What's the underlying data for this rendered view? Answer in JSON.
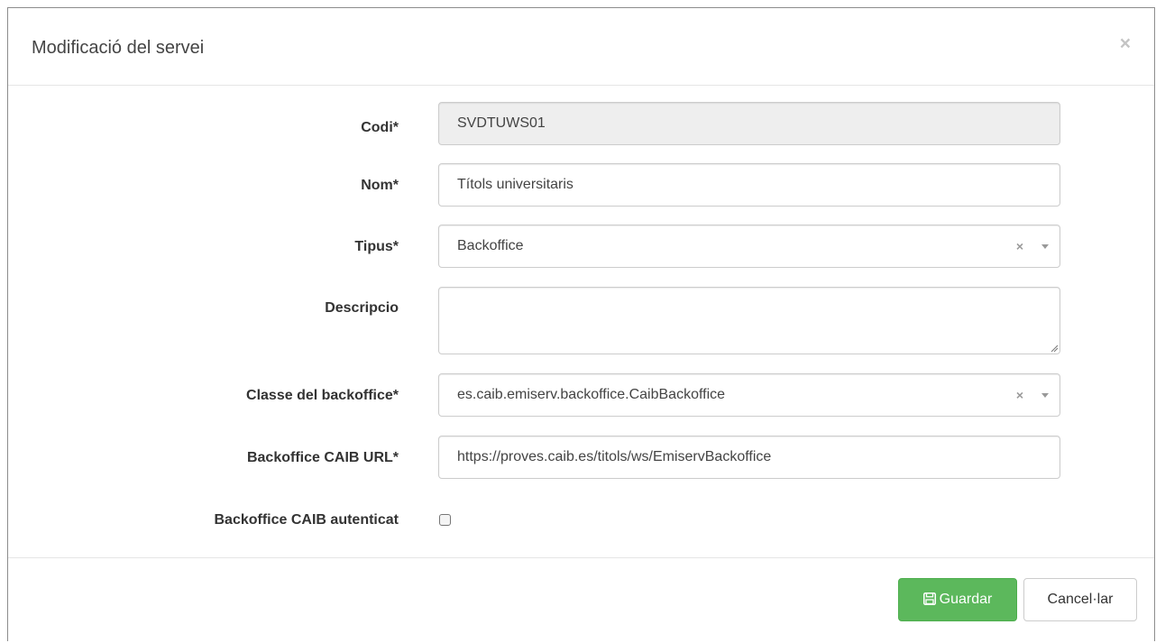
{
  "modal": {
    "title": "Modificació del servei",
    "close_label": "×"
  },
  "form": {
    "codi": {
      "label": "Codi*",
      "value": "SVDTUWS01"
    },
    "nom": {
      "label": "Nom*",
      "value": "Títols universitaris"
    },
    "tipus": {
      "label": "Tipus*",
      "value": "Backoffice",
      "clear": "×"
    },
    "descripcio": {
      "label": "Descripcio",
      "value": ""
    },
    "classe": {
      "label": "Classe del backoffice*",
      "value": "es.caib.emiserv.backoffice.CaibBackoffice",
      "clear": "×"
    },
    "url": {
      "label": "Backoffice CAIB URL*",
      "value": "https://proves.caib.es/titols/ws/EmiservBackoffice"
    },
    "autenticat": {
      "label": "Backoffice CAIB autenticat",
      "checked": false
    }
  },
  "footer": {
    "save_label": "Guardar",
    "cancel_label": "Cancel·lar"
  },
  "colors": {
    "save_button": "#5cb85c",
    "readonly_field": "#eeeeee"
  }
}
